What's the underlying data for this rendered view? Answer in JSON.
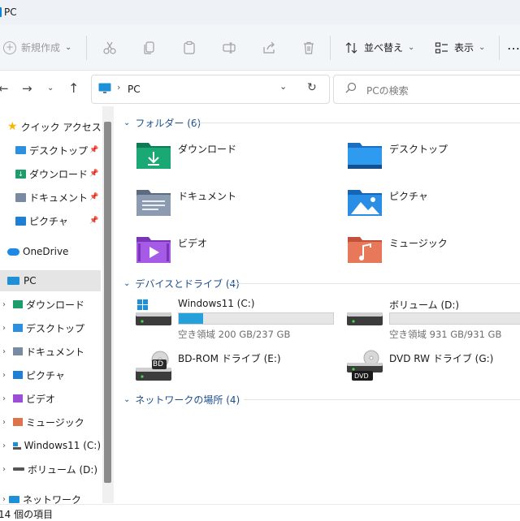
{
  "window": {
    "title": "PC"
  },
  "toolbar": {
    "new_label": "新規作成",
    "sort_label": "並べ替え",
    "view_label": "表示",
    "more_label": "…"
  },
  "address": {
    "path": "PC",
    "search_placeholder": "PCの検索"
  },
  "sidebar": {
    "quick_access": "クイック アクセス",
    "quick_items": [
      "デスクトップ",
      "ダウンロード",
      "ドキュメント",
      "ピクチャ"
    ],
    "onedrive": "OneDrive",
    "pc": "PC",
    "pc_items": [
      "ダウンロード",
      "デスクトップ",
      "ドキュメント",
      "ピクチャ",
      "ビデオ",
      "ミュージック",
      "Windows11 (C:)",
      "ボリューム (D:)"
    ],
    "network": "ネットワーク"
  },
  "content": {
    "folders_header": "フォルダー (6)",
    "folders": [
      "ダウンロード",
      "デスクトップ",
      "ドキュメント",
      "ピクチャ",
      "ビデオ",
      "ミュージック"
    ],
    "devices_header": "デバイスとドライブ (4)",
    "drives": [
      {
        "name": "Windows11 (C:)",
        "free": "空き領域 200 GB/237 GB",
        "used_fraction": 0.16
      },
      {
        "name": "ボリューム (D:)",
        "free": "空き領域 931 GB/931 GB",
        "used_fraction": 0.0
      },
      {
        "name": "BD-ROM ドライブ (E:)",
        "badge": "BD"
      },
      {
        "name": "DVD RW ドライブ (G:)",
        "badge": "DVD"
      }
    ],
    "network_header": "ネットワークの場所 (4)"
  },
  "status": {
    "item_count": "14 個の項目"
  },
  "colors": {
    "accent": "#26a0da",
    "section": "#1c4e8a",
    "selected_bg": "#e5e5e5"
  }
}
